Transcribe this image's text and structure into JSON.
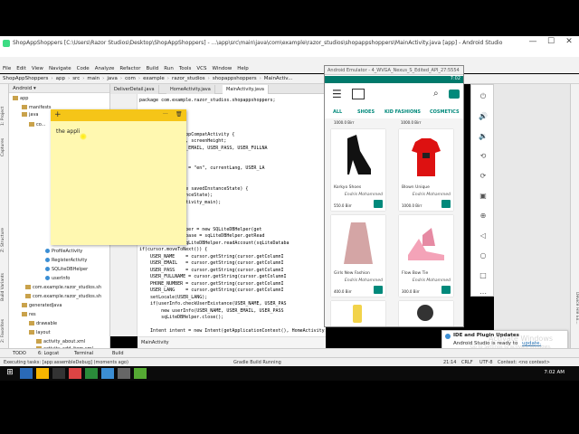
{
  "window": {
    "title": "ShopAppShoppers [C:\\Users\\Razor Studios\\Desktop\\ShopAppShoppers] - ...\\app\\src\\main\\java\\com\\example\\razor_studios\\shopappshoppers\\MainActivity.java [app] - Android Studio",
    "min_label": "—",
    "max_label": "☐",
    "close_label": "✕"
  },
  "menu": [
    "File",
    "Edit",
    "View",
    "Navigate",
    "Code",
    "Analyze",
    "Refactor",
    "Build",
    "Run",
    "Tools",
    "VCS",
    "Window",
    "Help"
  ],
  "breadcrumbs": [
    "ShopAppShoppers",
    "app",
    "src",
    "main",
    "java",
    "com",
    "example",
    "razor_studios",
    "shopappshoppers",
    "MainActiv..."
  ],
  "left_rail": [
    "1: Project",
    "Captures",
    "Z: Structure",
    "Build Variants",
    "2: Favorites"
  ],
  "right_rail": [
    "Device File Ex..."
  ],
  "project_panel": {
    "header": "Android",
    "nodes": [
      {
        "label": "app",
        "kind": "folder"
      },
      {
        "label": "manifests",
        "kind": "folder"
      },
      {
        "label": "java",
        "kind": "folder"
      },
      {
        "label": "co...",
        "kind": "folder"
      },
      {
        "label": "ProfileActivity",
        "kind": "class"
      },
      {
        "label": "RegisterActivity",
        "kind": "class"
      },
      {
        "label": "SQLiteDBHelper",
        "kind": "class"
      },
      {
        "label": "userInfo",
        "kind": "class"
      },
      {
        "label": "com.example.razor_studios.sh",
        "kind": "folder"
      },
      {
        "label": "com.example.razor_studios.sh",
        "kind": "folder"
      },
      {
        "label": "generatedJava",
        "kind": "folder"
      },
      {
        "label": "res",
        "kind": "folder"
      },
      {
        "label": "drawable",
        "kind": "folder"
      },
      {
        "label": "layout",
        "kind": "folder"
      },
      {
        "label": "activity_about.xml",
        "kind": "xml"
      },
      {
        "label": "activity_add_item.xml",
        "kind": "xml"
      }
    ]
  },
  "editor_tabs": [
    {
      "label": "DeliverDetail.java",
      "active": false
    },
    {
      "label": "HomeActivity.java",
      "active": false
    },
    {
      "label": "MainActivity.java",
      "active": true
    }
  ],
  "code_lines": [
    "package com.example.razor_studios.shopappshoppers;",
    "",
    "",
    "",
    "",
    "ctivity extends AppCompatActivity {",
    "c int screenWidth, screenHeight;",
    "g USER_NAME, USER_EMAIL, USER_PASS, USER_FULLNA",
    "user;",
    "cale;",
    "g currentLanguage = \"en\", currentLang, USER_LA",
    "",
    "",
    "id onCreate(Bundle savedInstanceState) {",
    "Create(savedInstanceState);",
    "tView(R.layout.activity_main);",
    "",
    "nguage();",
    "",
    "elper sqLiteDBHelper = new SQLiteDBHelper(get",
    "tabase sqLiteDatabase = sqLiteDBHelper.getRead",
    "cursor cursor = sqLiteDBHelper.readAccount(sqLiteDataba",
    "if(cursor.moveToNext()) {",
    "    USER_NAME    = cursor.getString(cursor.getColumnI",
    "    USER_EMAIL   = cursor.getString(cursor.getColumnI",
    "    USER_PASS    = cursor.getString(cursor.getColumnI",
    "    USER_FULLNAME = cursor.getString(cursor.getColumnI",
    "    PHONE_NUMBER = cursor.getString(cursor.getColumnI",
    "    USER_LANG    = cursor.getString(cursor.getColumnI",
    "    setLocale(USER_LANG);",
    "    if(userInfo.checkUserExistance(USER_NAME, USER_PAS",
    "        new userInfo(USER_NAME, USER_EMAIL, USER_PASS",
    "        sqLiteDBHelper.close();",
    "",
    "    Intent intent = new Intent(getApplicationContext(), HomeActivity.class);"
  ],
  "editor_breadcrumb": "MainActivity",
  "sticky_note": {
    "text": "the appli",
    "plus": "+",
    "dots": "···",
    "trash": "🗑"
  },
  "emulator": {
    "title": "Android Emulator - 4_WVGA_Nexus_S_Edited_API_27:5554",
    "time": "7:02",
    "categories": [
      "ALL",
      "SHOES",
      "KID FASHIONS",
      "COSMETICS"
    ],
    "top_prices": [
      "1000.0 Birr",
      "1000.0 Birr"
    ],
    "products": [
      {
        "name": "Korkyo Shoes",
        "seller": "Endris Mohammed",
        "price": "550.0 Birr"
      },
      {
        "name": "Blown Unique",
        "seller": "Endris Mohammed",
        "price": "1000.0 Birr"
      },
      {
        "name": "Girls New Fashion",
        "seller": "Endris Mohammed",
        "price": "400.0 Birr"
      },
      {
        "name": "Flow Bow Tie",
        "seller": "Endris Mohammed",
        "price": "300.0 Birr"
      }
    ]
  },
  "notification": {
    "title": "IDE and Plugin Updates",
    "body": "Android Studio is ready to",
    "link": "update."
  },
  "watermark": {
    "line1": "Activate Windows",
    "line2": "Go to Settings to activate Windows."
  },
  "bottom_tabs": [
    "TODO",
    "6: Logcat",
    "Terminal",
    "Build"
  ],
  "status": {
    "left": "Executing tasks: [app:assembleDebug] (moments ago)",
    "task": "Gradle Build Running",
    "pos": "21:14",
    "crlf": "CRLF",
    "enc": "UTF-8",
    "ctx": "Context: <no context>"
  },
  "taskbar": {
    "time": "7:02 AM"
  },
  "colors": {
    "accent": "#00897b",
    "sticky_header": "#f5c518",
    "sticky_body": "#fff8b0"
  }
}
